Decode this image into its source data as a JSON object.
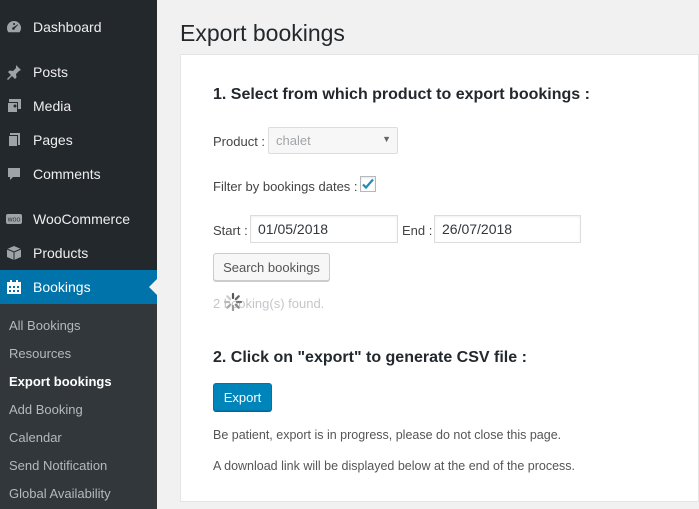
{
  "sidebar": {
    "menu": [
      {
        "label": "Dashboard",
        "icon": "dashboard-icon"
      },
      {
        "label": "Posts",
        "icon": "pin-icon"
      },
      {
        "label": "Media",
        "icon": "media-icon"
      },
      {
        "label": "Pages",
        "icon": "pages-icon"
      },
      {
        "label": "Comments",
        "icon": "comment-icon"
      },
      {
        "label": "WooCommerce",
        "icon": "woocommerce-icon"
      },
      {
        "label": "Products",
        "icon": "products-icon"
      },
      {
        "label": "Bookings",
        "icon": "calendar-icon"
      }
    ],
    "submenu": [
      "All Bookings",
      "Resources",
      "Export bookings",
      "Add Booking",
      "Calendar",
      "Send Notification",
      "Global Availability"
    ],
    "active_menu": "Bookings",
    "current_submenu": "Export bookings"
  },
  "page": {
    "title": "Export bookings",
    "step1_heading": "1. Select from which product to export bookings :",
    "product_label": "Product :",
    "product_value": "chalet",
    "filter_label": "Filter by bookings dates :",
    "filter_checked": true,
    "start_label": "Start :",
    "start_value": "01/05/2018",
    "end_label": "End :",
    "end_value": "26/07/2018",
    "search_button": "Search bookings",
    "found_text": "2 booking(s) found.",
    "step2_heading": "2. Click on \"export\" to generate CSV file :",
    "export_button": "Export",
    "note_patience": "Be patient, export is in progress, please do not close this page.",
    "note_download": "A download link will be displayed below at the end of the process."
  },
  "colors": {
    "sidebar_bg": "#23282d",
    "submenu_bg": "#32373c",
    "accent": "#0073aa",
    "primary_button": "#0085ba"
  }
}
